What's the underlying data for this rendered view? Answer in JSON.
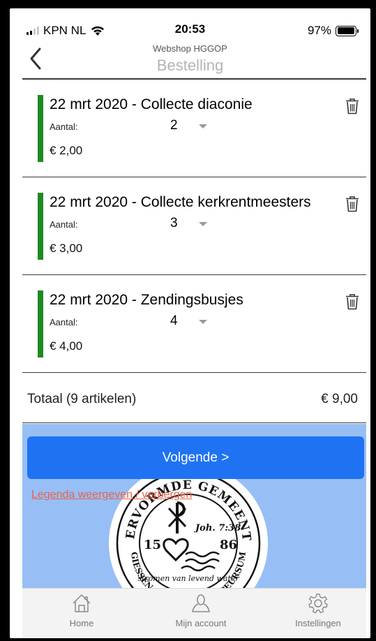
{
  "status_bar": {
    "carrier": "KPN NL",
    "time": "20:53",
    "battery": "97%",
    "battery_level": 0.97
  },
  "nav": {
    "subtitle": "Webshop HGGOP",
    "title": "Bestelling",
    "back_icon": "chevron-left-icon"
  },
  "items": [
    {
      "title": "22 mrt 2020 - Collecte diaconie",
      "qty_label": "Aantal:",
      "qty": "2",
      "price": "€ 2,00"
    },
    {
      "title": "22 mrt 2020 - Collecte kerkrentmeesters",
      "qty_label": "Aantal:",
      "qty": "3",
      "price": "€ 3,00"
    },
    {
      "title": "22 mrt 2020 - Zendingsbusjes",
      "qty_label": "Aantal:",
      "qty": "4",
      "price": "€ 4,00"
    }
  ],
  "total": {
    "label": "Totaal (9 artikelen)",
    "amount": "€ 9,00"
  },
  "actions": {
    "next_label": "Volgende >",
    "legend_link": "Legenda weergeven / verbergen"
  },
  "logo": {
    "ring_top": "HERVORMDE GEMEENTE",
    "year_left": "15",
    "year_right": "86",
    "verse": "Joh. 7:38",
    "motto": "stromen van levend water",
    "ring_bottom": "GIESSEN-OUDEKERK EN PEURSUM"
  },
  "tabbar": {
    "tabs": [
      {
        "label": "Home",
        "icon": "home-icon"
      },
      {
        "label": "Mijn account",
        "icon": "user-icon"
      },
      {
        "label": "Instellingen",
        "icon": "gear-icon"
      }
    ]
  },
  "colors": {
    "accent_blue": "#1f73f2",
    "item_bar_green": "#1f8a22",
    "link_red": "#e8624c",
    "hero_bg": "#97bff6"
  }
}
